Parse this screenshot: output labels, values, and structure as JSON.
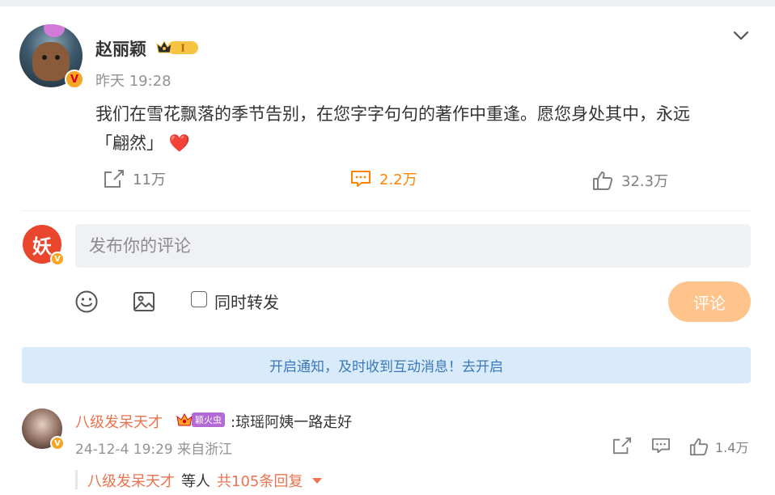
{
  "post": {
    "author": "赵丽颖",
    "member_level": "I",
    "time": "昨天 19:28",
    "text_line1": "我们在雪花飘落的季节告别，在您字字句句的著作中重逢。愿您身处其中，永远",
    "text_line2": "「翩然」",
    "heart": "❤️",
    "stats": {
      "shares": "11万",
      "comments": "2.2万",
      "likes": "32.3万"
    },
    "verified_badge": "V"
  },
  "composer": {
    "avatar_text": "妖",
    "placeholder": "发布你的评论",
    "repost_label": "同时转发",
    "submit_label": "评论",
    "verified_badge": "V"
  },
  "notice": {
    "text": "开启通知，及时收到互动消息！去开启"
  },
  "comments": [
    {
      "user": "八级发呆天才",
      "fan_tag": "颖火虫",
      "text": ":琼瑶阿姨一路走好",
      "meta": "24-12-4 19:29 来自浙江",
      "likes": "1.4万",
      "verified_badge": "V",
      "reply_summary": {
        "user": "八级发呆天才",
        "mid": "等人",
        "count": "共105条回复"
      }
    }
  ],
  "colors": {
    "accent_orange": "#ff8200",
    "username_orange": "#eb7350",
    "notice_bg": "#d9ebfb",
    "notice_text": "#3a78b8",
    "submit_bg": "#ffc48c"
  }
}
